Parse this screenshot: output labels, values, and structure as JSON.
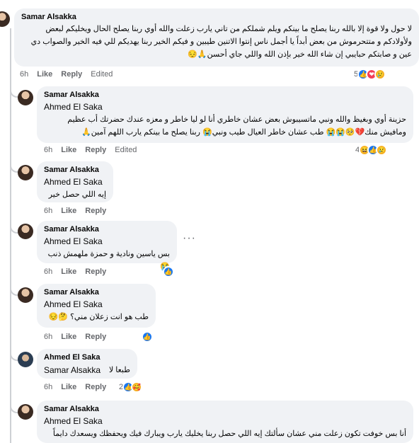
{
  "comments": [
    {
      "author": "Samar Alsakka",
      "text": "لا حول ولا قوة إلا بالله ربنا يصلح ما بينكم ويلم شملكم من تاني يارب زعلت والله أوي ربنا يصلح الحال ويخليكم لبعض ولأولادكم و متتحرموش من بعض أبداً يا أجمل ناس إنتوا الاتنين طيبين و فيكم الخير ربنا يهديكم للي فيه الخير والصواب دي عين و صابتكم حبايبي إن شاء الله خير بإذن الله واللي جاي أحسن🙏😔",
      "time": "6h",
      "like": "Like",
      "reply": "Reply",
      "edited": "Edited",
      "react_count": "5"
    },
    {
      "author": "Samar Alsakka",
      "mention": "Ahmed El Saka",
      "text": "حزينة أوي وبغيظ والله ونبي ماتسيبوش بعض عشان خاطري أنا لو ليا خاطر و معزه عندك حضرتك أب عظيم ومافيش منك💔🥺😭😭 طب عشان خاطر العيال طيب ونبي😭 ربنا يصلح ما بينكم يارب اللهم آمين🙏",
      "time": "6h",
      "like": "Like",
      "reply": "Reply",
      "edited": "Edited",
      "react_count": "4"
    },
    {
      "author": "Samar Alsakka",
      "mention": "Ahmed El Saka",
      "text": "إيه اللي حصل خير",
      "time": "6h",
      "like": "Like",
      "reply": "Reply"
    },
    {
      "author": "Samar Alsakka",
      "mention": "Ahmed El Saka",
      "text": "بس ياسين ونادية و حمزة ملهمش ذنب😭",
      "time": "6h",
      "like": "Like",
      "reply": "Reply",
      "more": "···"
    },
    {
      "author": "Samar Alsakka",
      "mention": "Ahmed El Saka",
      "text": "طب هو انت زعلان مني؟ 🤔😔",
      "time": "6h",
      "like": "Like",
      "reply": "Reply"
    },
    {
      "author": "Ahmed El Saka",
      "mention": "Samar Alsakka",
      "text": "طبعا لا",
      "time": "6h",
      "like": "Like",
      "reply": "Reply",
      "react_count": "2"
    },
    {
      "author": "Samar Alsakka",
      "mention": "Ahmed El Saka",
      "text": "أنا بس خوفت تكون زعلت مني عشان سألتك إيه اللي حصل ربنا يخليك يارب ويبارك فيك ويحفظك ويسعدك دايماً",
      "time": "6h",
      "like": "Like",
      "reply": "Reply"
    }
  ],
  "icons": {
    "like": "👍",
    "love": "❤",
    "sad": "😢",
    "haha": "😆",
    "care": "🥰"
  },
  "colors": {
    "like": "#1877f2",
    "love": "#f33e58",
    "bubble": "#f0f2f5",
    "meta": "#65676b"
  }
}
